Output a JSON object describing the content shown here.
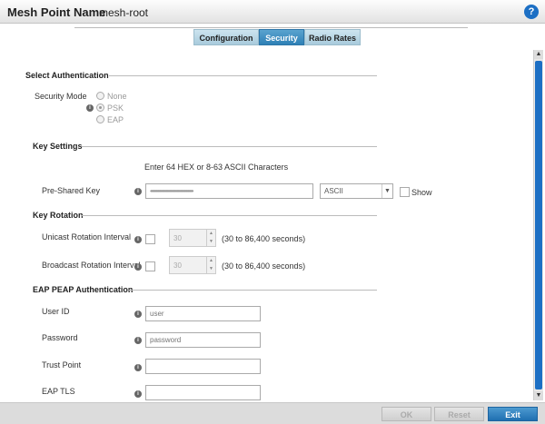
{
  "header": {
    "title_label": "Mesh Point Name",
    "title_value": "mesh-root",
    "help_icon": "question-icon",
    "help_text": "?"
  },
  "tabs": [
    {
      "label": "Configuration",
      "active": false
    },
    {
      "label": "Security",
      "active": true
    },
    {
      "label": "Radio Rates",
      "active": false
    }
  ],
  "authentication": {
    "section_title": "Select Authentication",
    "security_mode_label": "Security Mode",
    "options": [
      "None",
      "PSK",
      "EAP"
    ],
    "selected": "PSK"
  },
  "key_settings": {
    "section_title": "Key Settings",
    "hint": "Enter 64 HEX or 8-63 ASCII Characters",
    "psk_label": "Pre-Shared Key",
    "psk_value": "••••••••••••••••••••••••••••••••••••••••••••••••••••••••••",
    "format_value": "ASCII",
    "show_label": "Show"
  },
  "key_rotation": {
    "section_title": "Key Rotation",
    "unicast_label": "Unicast Rotation Interval",
    "unicast_value": "30",
    "unicast_range": "(30 to 86,400 seconds)",
    "broadcast_label": "Broadcast Rotation Interval",
    "broadcast_value": "30",
    "broadcast_range": "(30 to 86,400 seconds)"
  },
  "eap_peap": {
    "section_title": "EAP PEAP Authentication",
    "user_id_label": "User ID",
    "user_id_placeholder": "user",
    "password_label": "Password",
    "password_placeholder": "password",
    "trust_point_label": "Trust Point",
    "eap_tls_label": "EAP TLS"
  },
  "footer": {
    "ok_label": "OK",
    "reset_label": "Reset",
    "exit_label": "Exit"
  },
  "icons": {
    "info": "info-icon",
    "info_glyph": "i"
  },
  "colors": {
    "accent": "#1c6fc4",
    "tab_active": "#2e80b6"
  }
}
